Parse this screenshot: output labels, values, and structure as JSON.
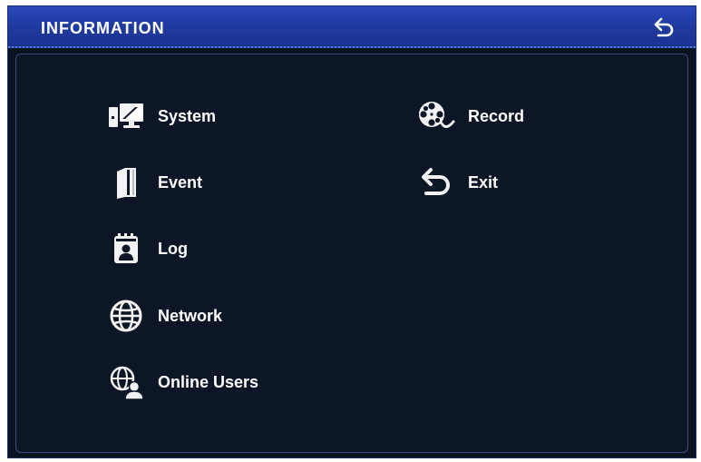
{
  "window": {
    "title": "INFORMATION",
    "back_icon": "back-arrow-icon"
  },
  "menu": {
    "left": [
      {
        "label": "System",
        "icon": "system-icon"
      },
      {
        "label": "Event",
        "icon": "event-icon"
      },
      {
        "label": "Log",
        "icon": "log-icon"
      },
      {
        "label": "Network",
        "icon": "network-icon"
      },
      {
        "label": "Online Users",
        "icon": "online-users-icon"
      }
    ],
    "right": [
      {
        "label": "Record",
        "icon": "record-icon"
      },
      {
        "label": "Exit",
        "icon": "exit-icon"
      }
    ]
  },
  "colors": {
    "titlebar": "#1f3aa0",
    "background": "#0b1220",
    "text": "#ffffff"
  }
}
